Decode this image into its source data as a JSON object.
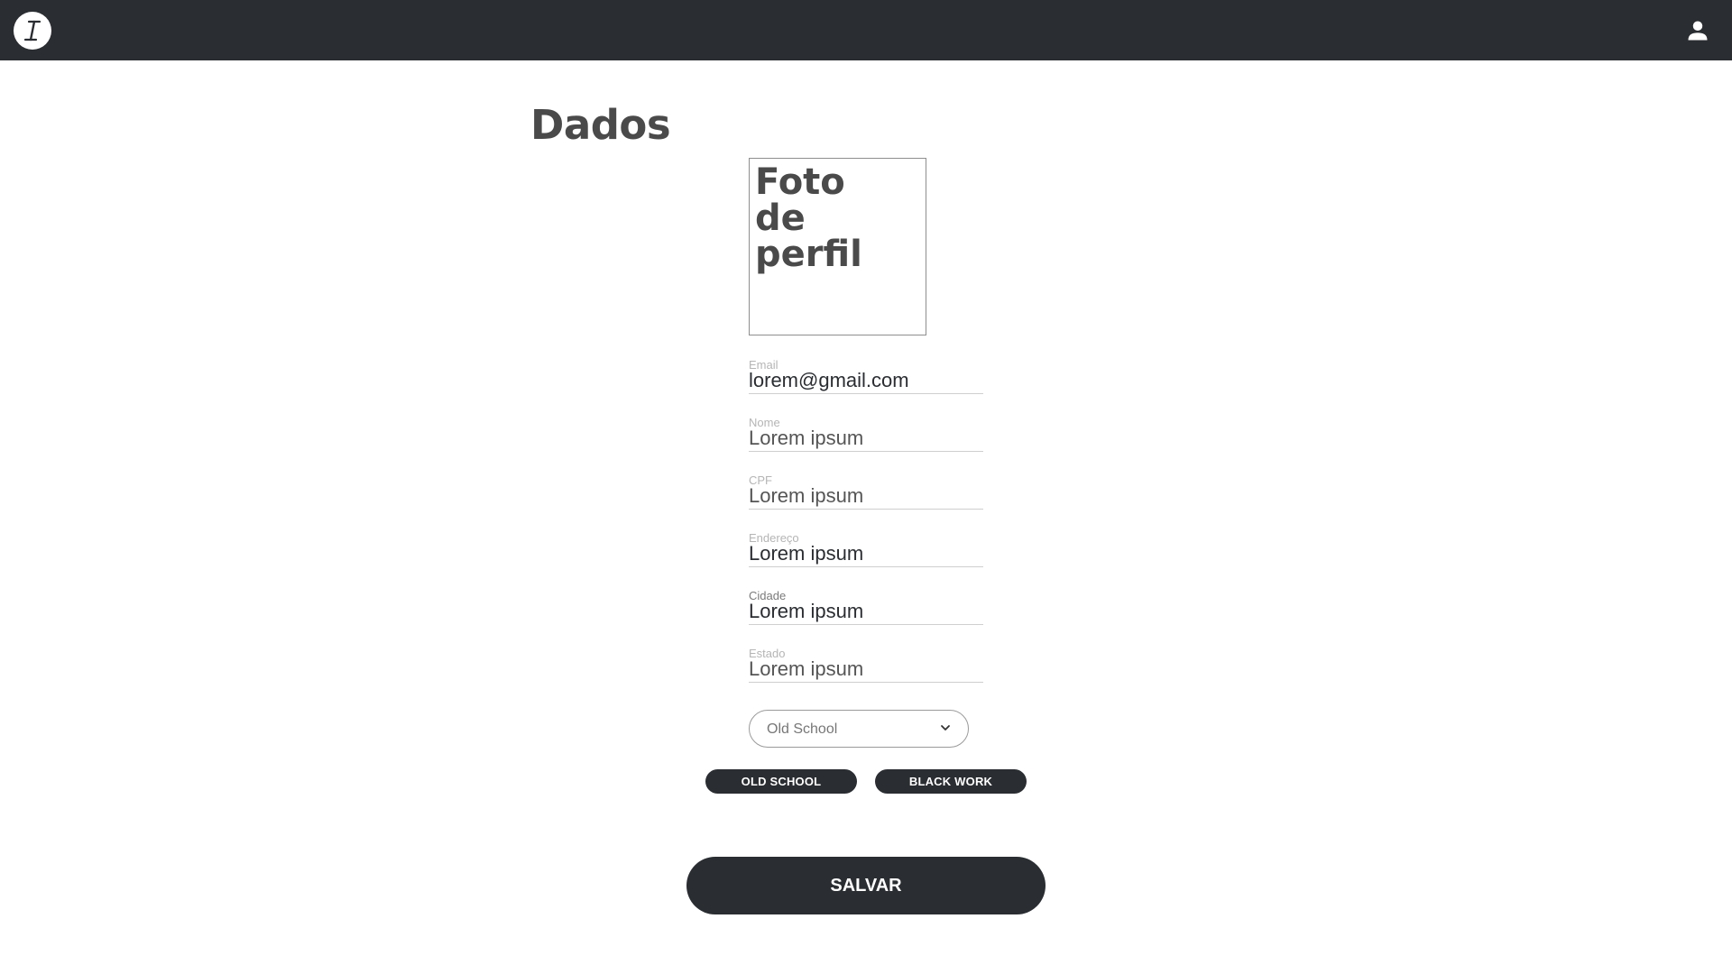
{
  "header": {
    "logo_icon": "italic-i-logo-icon",
    "user_icon": "user-icon",
    "background": "#2a2d31"
  },
  "page": {
    "title": "Dados"
  },
  "profile_photo": {
    "label": "Foto\nde\nperfil"
  },
  "fields": [
    {
      "label": "Email",
      "value": "lorem@gmail.com"
    },
    {
      "label": "Nome",
      "value": "Lorem ipsum"
    },
    {
      "label": "CPF",
      "value": "Lorem ipsum"
    },
    {
      "label": "Endereço",
      "value": "Lorem ipsum"
    },
    {
      "label": "Cidade",
      "value": "Lorem ipsum"
    },
    {
      "label": "Estado",
      "value": "Lorem ipsum"
    }
  ],
  "style_select": {
    "selected": "Old School",
    "icon": "chevron-down-icon"
  },
  "tags": [
    {
      "label": "OLD SCHOOL"
    },
    {
      "label": "BLACK WORK"
    }
  ],
  "actions": {
    "save_label": "SALVAR"
  }
}
